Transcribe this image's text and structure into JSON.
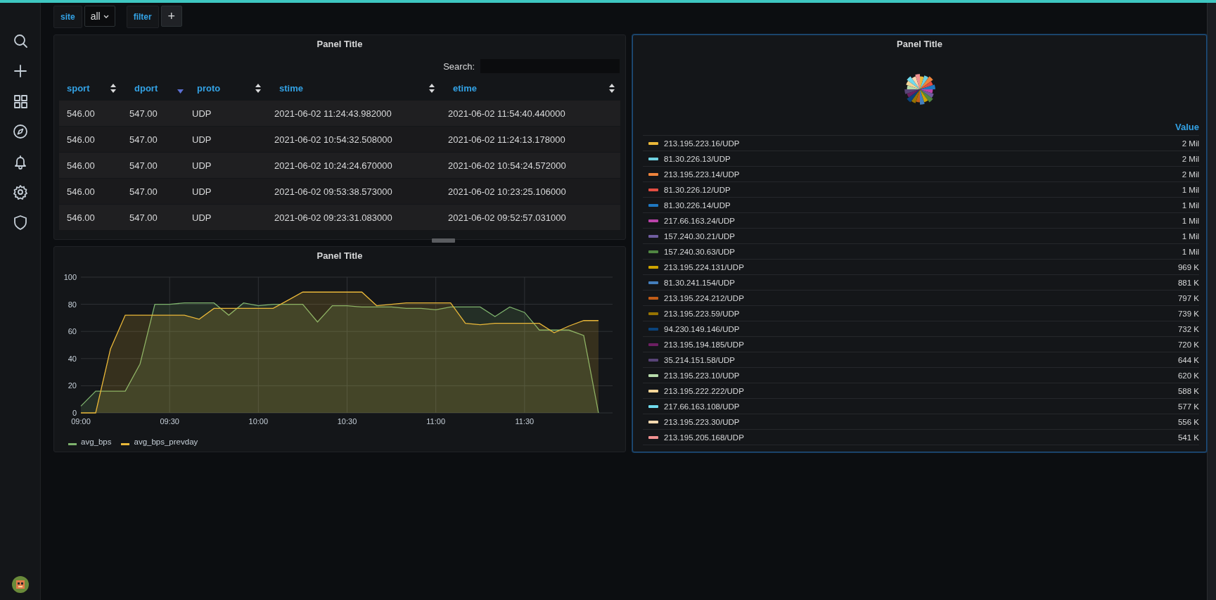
{
  "variables": [
    {
      "kind": "dropdown",
      "label": "site",
      "value": "all"
    },
    {
      "kind": "adhoc",
      "label": "filter",
      "add": "+"
    }
  ],
  "table_panel": {
    "title": "Panel Title",
    "search_label": "Search:",
    "columns": [
      {
        "label": "sport",
        "sorted": false
      },
      {
        "label": "dport",
        "sorted": true
      },
      {
        "label": "proto",
        "sorted": false
      },
      {
        "label": "stime",
        "sorted": false
      },
      {
        "label": "etime",
        "sorted": false
      }
    ],
    "rows": [
      [
        "546.00",
        "547.00",
        "UDP",
        "2021-06-02 11:24:43.982000",
        "2021-06-02 11:54:40.440000"
      ],
      [
        "546.00",
        "547.00",
        "UDP",
        "2021-06-02 10:54:32.508000",
        "2021-06-02 11:24:13.178000"
      ],
      [
        "546.00",
        "547.00",
        "UDP",
        "2021-06-02 10:24:24.670000",
        "2021-06-02 10:54:24.572000"
      ],
      [
        "546.00",
        "547.00",
        "UDP",
        "2021-06-02 09:53:38.573000",
        "2021-06-02 10:23:25.106000"
      ],
      [
        "546.00",
        "547.00",
        "UDP",
        "2021-06-02 09:23:31.083000",
        "2021-06-02 09:52:57.031000"
      ]
    ]
  },
  "graph_panel": {
    "title": "Panel Title",
    "chart_data": {
      "type": "area",
      "categories": [
        "09:00",
        null,
        null,
        null,
        null,
        null,
        "09:30",
        null,
        null,
        null,
        null,
        null,
        "10:00",
        null,
        null,
        null,
        null,
        null,
        "10:30",
        null,
        null,
        null,
        null,
        null,
        "11:00",
        null,
        null,
        null,
        null,
        null,
        "11:30",
        null,
        null,
        null,
        null,
        null
      ],
      "series": [
        {
          "name": "avg_bps",
          "color": "#7eb26d",
          "values": [
            5,
            16,
            16,
            16,
            36,
            80,
            80,
            81,
            81,
            81,
            72,
            81,
            79,
            80,
            80,
            80,
            67,
            79,
            79,
            78,
            78,
            78,
            77,
            77,
            76,
            78,
            78,
            78,
            71,
            78,
            74,
            61,
            61,
            61,
            57,
            0
          ]
        },
        {
          "name": "avg_bps_prevday",
          "color": "#eab839",
          "values": [
            0,
            0,
            47,
            72,
            72,
            72,
            72,
            72,
            69,
            77,
            77,
            77,
            77,
            77,
            83,
            89,
            89,
            89,
            89,
            89,
            79,
            80,
            81,
            81,
            81,
            81,
            66,
            65,
            66,
            66,
            66,
            66,
            59,
            64,
            68,
            68
          ]
        }
      ],
      "ylim": [
        0,
        100
      ],
      "yticks": [
        0,
        20,
        40,
        60,
        80,
        100
      ],
      "grid": true
    }
  },
  "pie_panel": {
    "title": "Panel Title",
    "value_header": "Value",
    "legend": [
      {
        "name": "213.195.223.16/UDP",
        "value": "2 Mil",
        "color": "#eab839"
      },
      {
        "name": "81.30.226.13/UDP",
        "value": "2 Mil",
        "color": "#6ed0e0"
      },
      {
        "name": "213.195.223.14/UDP",
        "value": "2 Mil",
        "color": "#ef843c"
      },
      {
        "name": "81.30.226.12/UDP",
        "value": "1 Mil",
        "color": "#e24d42"
      },
      {
        "name": "81.30.226.14/UDP",
        "value": "1 Mil",
        "color": "#1f78c1"
      },
      {
        "name": "217.66.163.24/UDP",
        "value": "1 Mil",
        "color": "#ba43a9"
      },
      {
        "name": "157.240.30.21/UDP",
        "value": "1 Mil",
        "color": "#705da0"
      },
      {
        "name": "157.240.30.63/UDP",
        "value": "1 Mil",
        "color": "#508642"
      },
      {
        "name": "213.195.224.131/UDP",
        "value": "969 K",
        "color": "#cca300"
      },
      {
        "name": "81.30.241.154/UDP",
        "value": "881 K",
        "color": "#447ebc"
      },
      {
        "name": "213.195.224.212/UDP",
        "value": "797 K",
        "color": "#c15c17"
      },
      {
        "name": "213.195.223.59/UDP",
        "value": "739 K",
        "color": "#967302"
      },
      {
        "name": "94.230.149.146/UDP",
        "value": "732 K",
        "color": "#0a437c"
      },
      {
        "name": "213.195.194.185/UDP",
        "value": "720 K",
        "color": "#6d1f62"
      },
      {
        "name": "35.214.151.58/UDP",
        "value": "644 K",
        "color": "#584477"
      },
      {
        "name": "213.195.223.10/UDP",
        "value": "620 K",
        "color": "#b7dbab"
      },
      {
        "name": "213.195.222.222/UDP",
        "value": "588 K",
        "color": "#f4d598"
      },
      {
        "name": "217.66.163.108/UDP",
        "value": "577 K",
        "color": "#70dbed"
      },
      {
        "name": "213.195.223.30/UDP",
        "value": "556 K",
        "color": "#f9d9b0"
      },
      {
        "name": "213.195.205.168/UDP",
        "value": "541 K",
        "color": "#f29191"
      }
    ]
  }
}
